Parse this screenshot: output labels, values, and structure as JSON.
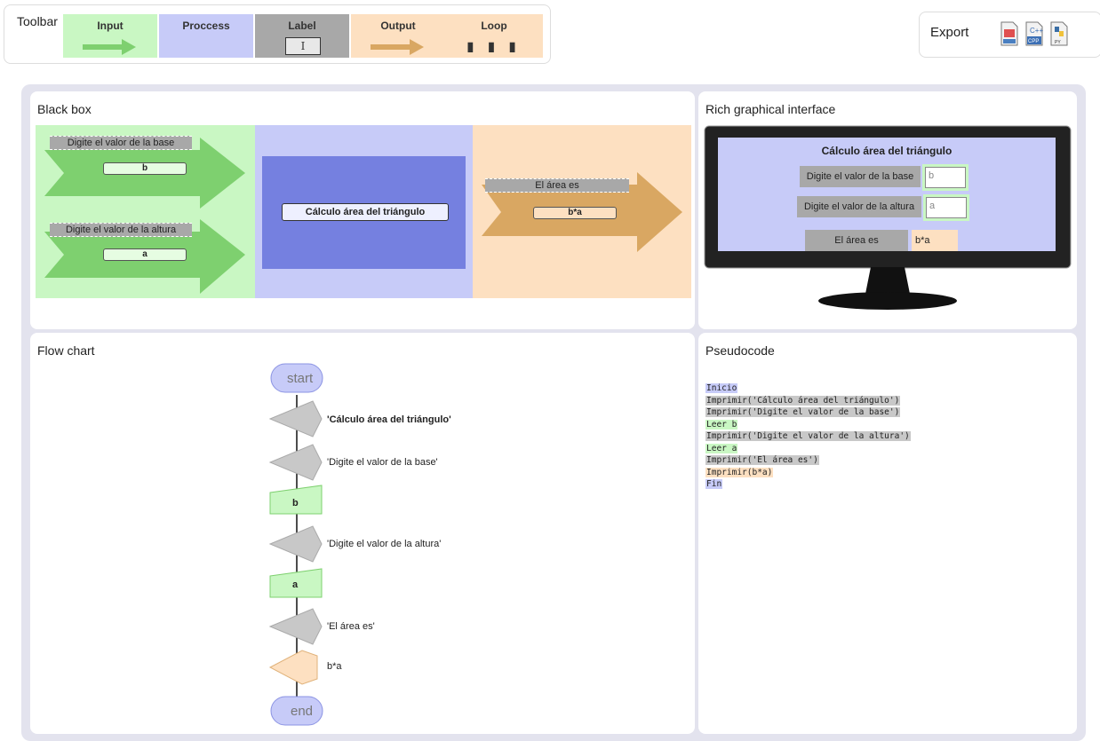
{
  "toolbar": {
    "title": "Toolbar",
    "tools": {
      "input": "Input",
      "process": "Proccess",
      "label": "Label",
      "label_cursor": "I",
      "output": "Output",
      "loop": "Loop",
      "loop_symbol": "▮ ▮ ▮"
    }
  },
  "export": {
    "title": "Export",
    "icons": [
      "pdf-icon",
      "cpp-icon",
      "python-icon"
    ]
  },
  "black_box": {
    "title": "Black box",
    "input1_label": "Digite el valor de la base",
    "input1_var": "b",
    "input2_label": "Digite el valor de la altura",
    "input2_var": "a",
    "process_label": "Cálculo área del triángulo",
    "output_label": "El área es",
    "output_expr": "b*a"
  },
  "gui": {
    "title": "Rich graphical interface",
    "screen_title": "Cálculo área del triángulo",
    "field1_label": "Digite el valor de la base",
    "field1_value": "b",
    "field2_label": "Digite el valor de la altura",
    "field2_value": "a",
    "output_label": "El área es",
    "output_value": "b*a"
  },
  "flow": {
    "title": "Flow chart",
    "start": "start",
    "end": "end",
    "out1": "'Cálculo área del triángulo'",
    "out2": "'Digite el valor de la base'",
    "in1": "b",
    "out3": "'Digite el valor de la altura'",
    "in2": "a",
    "out4": "'El área es'",
    "out5": "b*a"
  },
  "pseudo": {
    "title": "Pseudocode",
    "lines": [
      {
        "text": "Inicio",
        "kind": "process"
      },
      {
        "text": "Imprimir('Cálculo área del triángulo')",
        "kind": "label"
      },
      {
        "text": "Imprimir('Digite el valor de la base')",
        "kind": "label"
      },
      {
        "text": "Leer b",
        "kind": "input"
      },
      {
        "text": "Imprimir('Digite el valor de la altura')",
        "kind": "label"
      },
      {
        "text": "Leer a",
        "kind": "input"
      },
      {
        "text": "Imprimir('El área es')",
        "kind": "label"
      },
      {
        "text": "Imprimir(b*a)",
        "kind": "output"
      },
      {
        "text": "Fin",
        "kind": "process"
      }
    ]
  },
  "colors": {
    "input": "#c9f7c3",
    "process": "#c7cbf8",
    "label": "#a8a8a8",
    "output": "#fde0c1"
  }
}
